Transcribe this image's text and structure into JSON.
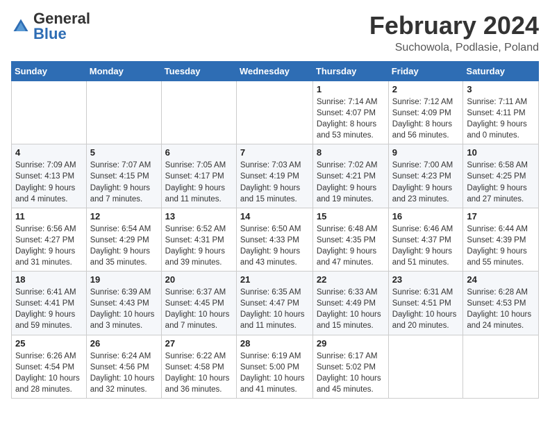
{
  "header": {
    "logo_general": "General",
    "logo_blue": "Blue",
    "month_title": "February 2024",
    "location": "Suchowola, Podlasie, Poland"
  },
  "weekdays": [
    "Sunday",
    "Monday",
    "Tuesday",
    "Wednesday",
    "Thursday",
    "Friday",
    "Saturday"
  ],
  "weeks": [
    [
      {
        "day": "",
        "info": ""
      },
      {
        "day": "",
        "info": ""
      },
      {
        "day": "",
        "info": ""
      },
      {
        "day": "",
        "info": ""
      },
      {
        "day": "1",
        "info": "Sunrise: 7:14 AM\nSunset: 4:07 PM\nDaylight: 8 hours\nand 53 minutes."
      },
      {
        "day": "2",
        "info": "Sunrise: 7:12 AM\nSunset: 4:09 PM\nDaylight: 8 hours\nand 56 minutes."
      },
      {
        "day": "3",
        "info": "Sunrise: 7:11 AM\nSunset: 4:11 PM\nDaylight: 9 hours\nand 0 minutes."
      }
    ],
    [
      {
        "day": "4",
        "info": "Sunrise: 7:09 AM\nSunset: 4:13 PM\nDaylight: 9 hours\nand 4 minutes."
      },
      {
        "day": "5",
        "info": "Sunrise: 7:07 AM\nSunset: 4:15 PM\nDaylight: 9 hours\nand 7 minutes."
      },
      {
        "day": "6",
        "info": "Sunrise: 7:05 AM\nSunset: 4:17 PM\nDaylight: 9 hours\nand 11 minutes."
      },
      {
        "day": "7",
        "info": "Sunrise: 7:03 AM\nSunset: 4:19 PM\nDaylight: 9 hours\nand 15 minutes."
      },
      {
        "day": "8",
        "info": "Sunrise: 7:02 AM\nSunset: 4:21 PM\nDaylight: 9 hours\nand 19 minutes."
      },
      {
        "day": "9",
        "info": "Sunrise: 7:00 AM\nSunset: 4:23 PM\nDaylight: 9 hours\nand 23 minutes."
      },
      {
        "day": "10",
        "info": "Sunrise: 6:58 AM\nSunset: 4:25 PM\nDaylight: 9 hours\nand 27 minutes."
      }
    ],
    [
      {
        "day": "11",
        "info": "Sunrise: 6:56 AM\nSunset: 4:27 PM\nDaylight: 9 hours\nand 31 minutes."
      },
      {
        "day": "12",
        "info": "Sunrise: 6:54 AM\nSunset: 4:29 PM\nDaylight: 9 hours\nand 35 minutes."
      },
      {
        "day": "13",
        "info": "Sunrise: 6:52 AM\nSunset: 4:31 PM\nDaylight: 9 hours\nand 39 minutes."
      },
      {
        "day": "14",
        "info": "Sunrise: 6:50 AM\nSunset: 4:33 PM\nDaylight: 9 hours\nand 43 minutes."
      },
      {
        "day": "15",
        "info": "Sunrise: 6:48 AM\nSunset: 4:35 PM\nDaylight: 9 hours\nand 47 minutes."
      },
      {
        "day": "16",
        "info": "Sunrise: 6:46 AM\nSunset: 4:37 PM\nDaylight: 9 hours\nand 51 minutes."
      },
      {
        "day": "17",
        "info": "Sunrise: 6:44 AM\nSunset: 4:39 PM\nDaylight: 9 hours\nand 55 minutes."
      }
    ],
    [
      {
        "day": "18",
        "info": "Sunrise: 6:41 AM\nSunset: 4:41 PM\nDaylight: 9 hours\nand 59 minutes."
      },
      {
        "day": "19",
        "info": "Sunrise: 6:39 AM\nSunset: 4:43 PM\nDaylight: 10 hours\nand 3 minutes."
      },
      {
        "day": "20",
        "info": "Sunrise: 6:37 AM\nSunset: 4:45 PM\nDaylight: 10 hours\nand 7 minutes."
      },
      {
        "day": "21",
        "info": "Sunrise: 6:35 AM\nSunset: 4:47 PM\nDaylight: 10 hours\nand 11 minutes."
      },
      {
        "day": "22",
        "info": "Sunrise: 6:33 AM\nSunset: 4:49 PM\nDaylight: 10 hours\nand 15 minutes."
      },
      {
        "day": "23",
        "info": "Sunrise: 6:31 AM\nSunset: 4:51 PM\nDaylight: 10 hours\nand 20 minutes."
      },
      {
        "day": "24",
        "info": "Sunrise: 6:28 AM\nSunset: 4:53 PM\nDaylight: 10 hours\nand 24 minutes."
      }
    ],
    [
      {
        "day": "25",
        "info": "Sunrise: 6:26 AM\nSunset: 4:54 PM\nDaylight: 10 hours\nand 28 minutes."
      },
      {
        "day": "26",
        "info": "Sunrise: 6:24 AM\nSunset: 4:56 PM\nDaylight: 10 hours\nand 32 minutes."
      },
      {
        "day": "27",
        "info": "Sunrise: 6:22 AM\nSunset: 4:58 PM\nDaylight: 10 hours\nand 36 minutes."
      },
      {
        "day": "28",
        "info": "Sunrise: 6:19 AM\nSunset: 5:00 PM\nDaylight: 10 hours\nand 41 minutes."
      },
      {
        "day": "29",
        "info": "Sunrise: 6:17 AM\nSunset: 5:02 PM\nDaylight: 10 hours\nand 45 minutes."
      },
      {
        "day": "",
        "info": ""
      },
      {
        "day": "",
        "info": ""
      }
    ]
  ]
}
